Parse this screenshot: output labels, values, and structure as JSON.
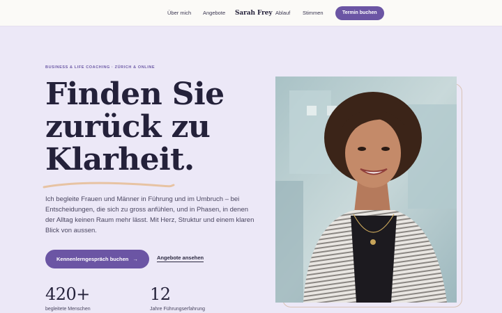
{
  "nav": {
    "links": [
      "Über mich",
      "Angebote",
      "Ablauf",
      "Stimmen"
    ],
    "brand": "Sarah Frey",
    "cta": "Termin buchen"
  },
  "hero": {
    "eyebrow": "BUSINESS & LIFE COACHING · ZÜRICH & ONLINE",
    "headline": [
      "Finden Sie",
      "zurück zu",
      "Klarheit."
    ],
    "lead": "Ich begleite Frauen und Männer in Führung und im Umbruch – bei Entscheidungen, die sich zu gross anfühlen, und in Phasen, in denen der Alltag keinen Raum mehr lässt. Mit Herz, Struktur und einem klaren Blick von aussen.",
    "primary_button": "Kennenlerngespräch buchen",
    "primary_arrow": "→",
    "secondary_link": "Angebote ansehen",
    "stats": [
      {
        "value": "420+",
        "label": "begleitete Menschen"
      },
      {
        "value": "12",
        "label": "Jahre Führungserfahrung"
      }
    ]
  },
  "colors": {
    "accent": "#6B55A4",
    "background": "#ECE8F7",
    "nav_background": "#FBFAF7",
    "headline": "#24213A",
    "underline": "#E7C3A3"
  },
  "icons": {
    "arrow": "arrow-right-icon"
  }
}
